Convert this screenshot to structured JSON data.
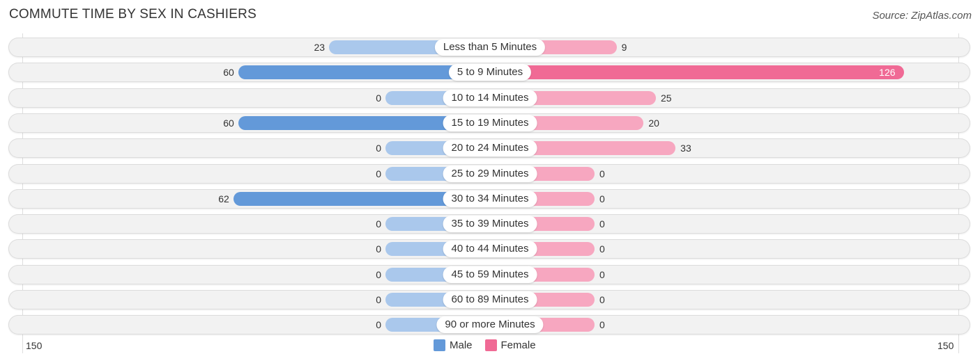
{
  "chart_data": {
    "type": "bar",
    "orientation": "horizontal-diverging",
    "title": "COMMUTE TIME BY SEX IN CASHIERS",
    "source": "Source: ZipAtlas.com",
    "categories": [
      "Less than 5 Minutes",
      "5 to 9 Minutes",
      "10 to 14 Minutes",
      "15 to 19 Minutes",
      "20 to 24 Minutes",
      "25 to 29 Minutes",
      "30 to 34 Minutes",
      "35 to 39 Minutes",
      "40 to 44 Minutes",
      "45 to 59 Minutes",
      "60 to 89 Minutes",
      "90 or more Minutes"
    ],
    "series": [
      {
        "name": "Male",
        "color": "#6399d9",
        "values": [
          23,
          60,
          0,
          60,
          0,
          0,
          62,
          0,
          0,
          0,
          0,
          0
        ]
      },
      {
        "name": "Female",
        "color": "#f06a95",
        "values": [
          9,
          126,
          25,
          20,
          33,
          0,
          0,
          0,
          0,
          0,
          0,
          0
        ]
      }
    ],
    "xlim": [
      150,
      150
    ],
    "axis_left_label": "150",
    "axis_right_label": "150",
    "legend": [
      "Male",
      "Female"
    ],
    "legend_position": "bottom-center"
  }
}
